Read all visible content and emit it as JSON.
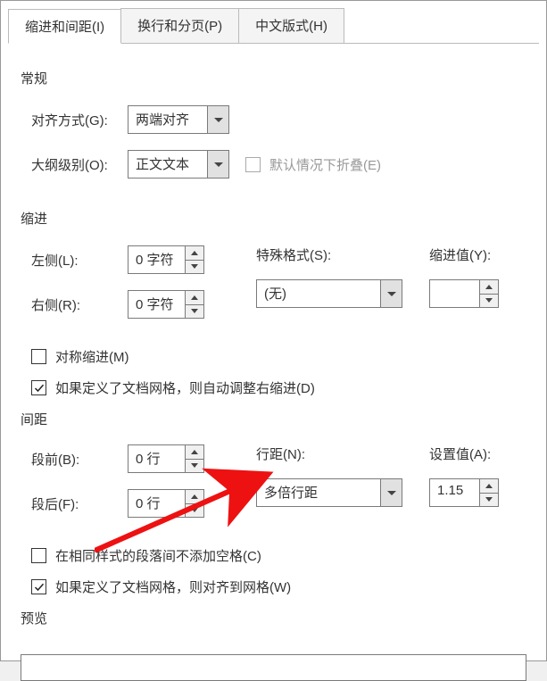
{
  "tabs": {
    "t1": "缩进和间距(I)",
    "t2": "换行和分页(P)",
    "t3": "中文版式(H)"
  },
  "general": {
    "title": "常规",
    "align_label": "对齐方式(G):",
    "align_value": "两端对齐",
    "outline_label": "大纲级别(O):",
    "outline_value": "正文文本",
    "collapse_label": "默认情况下折叠(E)"
  },
  "indent": {
    "title": "缩进",
    "left_label": "左侧(L):",
    "left_value": "0 字符",
    "right_label": "右侧(R):",
    "right_value": "0 字符",
    "special_label": "特殊格式(S):",
    "special_value": "(无)",
    "indent_val_label": "缩进值(Y):",
    "indent_val_value": "",
    "mirror_label": "对称缩进(M)",
    "grid_label": "如果定义了文档网格，则自动调整右缩进(D)"
  },
  "spacing": {
    "title": "间距",
    "before_label": "段前(B):",
    "before_value": "0 行",
    "after_label": "段后(F):",
    "after_value": "0 行",
    "line_label": "行距(N):",
    "line_value": "多倍行距",
    "setval_label": "设置值(A):",
    "setval_value": "1.15",
    "nospace_label": "在相同样式的段落间不添加空格(C)",
    "snap_label": "如果定义了文档网格，则对齐到网格(W)"
  },
  "preview": {
    "title": "预览"
  }
}
